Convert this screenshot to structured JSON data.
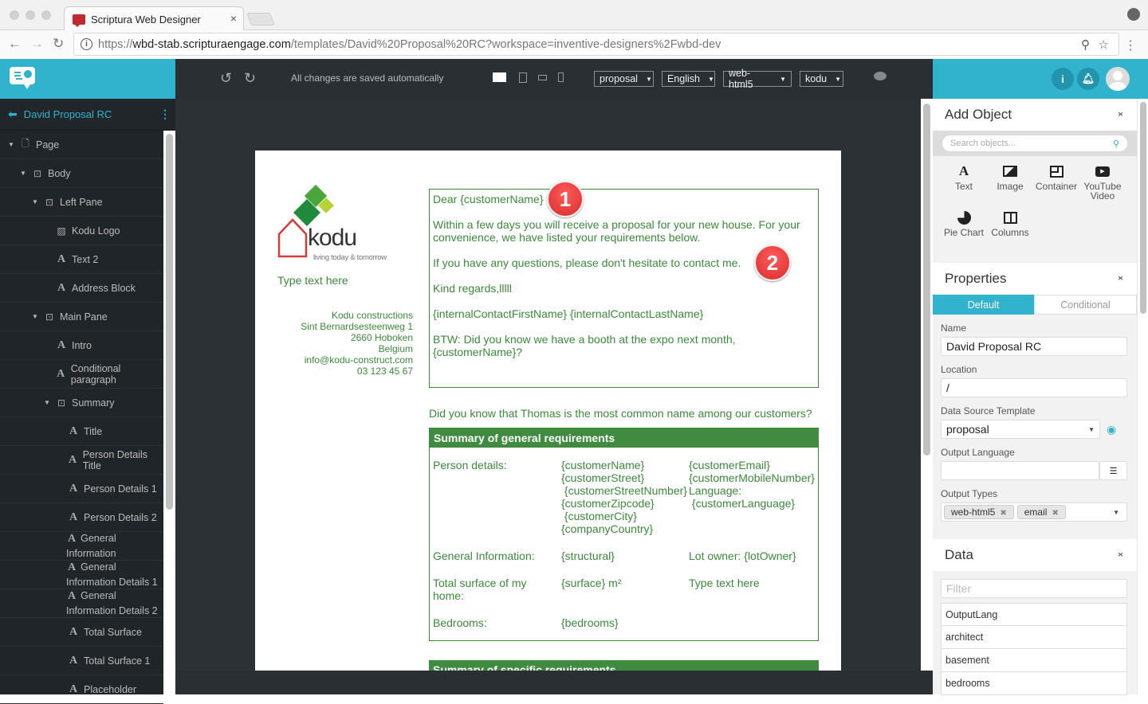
{
  "browser": {
    "tab_title": "Scriptura Web Designer",
    "tab_close": "×",
    "url_prefix": "https://",
    "url_domain": "wbd-stab.scripturaengage.com",
    "url_path": "/templates/David%20Proposal%20RC?workspace=inventive-designers%2Fwbd-dev"
  },
  "toolbar": {
    "saved_status": "All changes are saved automatically",
    "dropdowns": [
      "proposal",
      "English",
      "web-html5",
      "kodu"
    ]
  },
  "sidebar": {
    "title": "David Proposal RC",
    "items": [
      {
        "label": "Page",
        "icon": "page-icon",
        "level": 0,
        "expand": true
      },
      {
        "label": "Body",
        "icon": "container-icon",
        "level": 1,
        "expand": true
      },
      {
        "label": "Left Pane",
        "icon": "container-icon",
        "level": 2,
        "expand": true
      },
      {
        "label": "Kodu Logo",
        "icon": "image-icon",
        "level": 3
      },
      {
        "label": "Text 2",
        "icon": "text-icon",
        "level": 3
      },
      {
        "label": "Address Block",
        "icon": "text-icon",
        "level": 3
      },
      {
        "label": "Main Pane",
        "icon": "container-icon",
        "level": 2,
        "expand": true
      },
      {
        "label": "Intro",
        "icon": "text-icon",
        "level": 3
      },
      {
        "label": "Conditional paragraph",
        "icon": "text-icon",
        "level": 3
      },
      {
        "label": "Summary",
        "icon": "container-icon",
        "level": 3,
        "expand": true
      },
      {
        "label": "Title",
        "icon": "text-icon",
        "level": 4
      },
      {
        "label": "Person Details Title",
        "icon": "text-icon",
        "level": 4
      },
      {
        "label": "Person Details 1",
        "icon": "text-icon",
        "level": 4
      },
      {
        "label": "Person Details 2",
        "icon": "text-icon",
        "level": 4
      },
      {
        "label": "General Information",
        "icon": "text-icon",
        "level": 4,
        "wrap": true
      },
      {
        "label": "General Information Details 1",
        "icon": "text-icon",
        "level": 4,
        "wrap": true
      },
      {
        "label": "General Information Details 2",
        "icon": "text-icon",
        "level": 4,
        "wrap": true
      },
      {
        "label": "Total Surface",
        "icon": "text-icon",
        "level": 4
      },
      {
        "label": "Total Surface 1",
        "icon": "text-icon",
        "level": 4
      },
      {
        "label": "Placeholder",
        "icon": "text-icon",
        "level": 4
      }
    ]
  },
  "document": {
    "logo_text": "kodu",
    "logo_tagline": "living today & tomorrow",
    "type_text": "Type text here",
    "address": [
      "Kodu constructions",
      "Sint Bernardsesteenweg 1",
      "2660 Hoboken",
      "Belgium",
      "info@kodu-construct.com",
      "03 123 45 67"
    ],
    "intro": {
      "greeting": "Dear {customerName}",
      "p1": "Within a few days you will receive a proposal for your new house. For your convenience, we have listed your requirements below.",
      "p2": "If you have any questions, please don't hesitate to contact me.",
      "p3": "Kind regards,lllll",
      "p4": "{internalContactFirstName} {internalContactLastName}",
      "p5": "BTW: Did you know we have a booth at the expo next month,",
      "p5b": " {customerName}?"
    },
    "badges": [
      "1",
      "2"
    ],
    "fact": "Did you know that Thomas is the most common name among our customers?",
    "summary_title": "Summary of general requirements",
    "person_label": "Person details:",
    "person_col1": [
      "{customerName}",
      "{customerStreet}",
      " {customerStreetNumber}",
      "{customerZipcode}",
      " {customerCity}",
      "{companyCountry}"
    ],
    "person_col2": [
      "{customerEmail}",
      "{customerMobileNumber}",
      "Language:",
      " {customerLanguage}"
    ],
    "general_label": "General Information:",
    "general_value": "{structural}",
    "lot_owner": "Lot owner: {lotOwner}",
    "surface_label": "Total surface of my home:",
    "surface_value": "{surface} m²",
    "surface_extra": "Type text here",
    "bedrooms_label": "Bedrooms:",
    "bedrooms_value": "{bedrooms}",
    "summary2_title": "Summary of specific requirements"
  },
  "right_panel": {
    "add_object": {
      "title": "Add Object",
      "search_placeholder": "Search objects...",
      "objects": [
        {
          "label": "Text",
          "icon": "text-icon"
        },
        {
          "label": "Image",
          "icon": "image-icon"
        },
        {
          "label": "Container",
          "icon": "container-icon"
        },
        {
          "label": "YouTube Video",
          "icon": "youtube-icon"
        },
        {
          "label": "Pie Chart",
          "icon": "pie-chart-icon"
        },
        {
          "label": "Columns",
          "icon": "columns-icon"
        }
      ]
    },
    "properties": {
      "title": "Properties",
      "tab_default": "Default",
      "tab_conditional": "Conditional",
      "name_label": "Name",
      "name_value": "David Proposal RC",
      "location_label": "Location",
      "location_value": "/",
      "dst_label": "Data Source Template",
      "dst_value": "proposal",
      "lang_label": "Output Language",
      "lang_value": "",
      "types_label": "Output Types",
      "types": [
        "web-html5",
        "email"
      ]
    },
    "data": {
      "title": "Data",
      "filter_placeholder": "Filter",
      "items": [
        "OutputLang",
        "architect",
        "basement",
        "bedrooms"
      ]
    }
  },
  "colors": {
    "accent": "#31b2cd",
    "doc_green": "#3a8b3a",
    "badge_red": "#e03a3a"
  }
}
